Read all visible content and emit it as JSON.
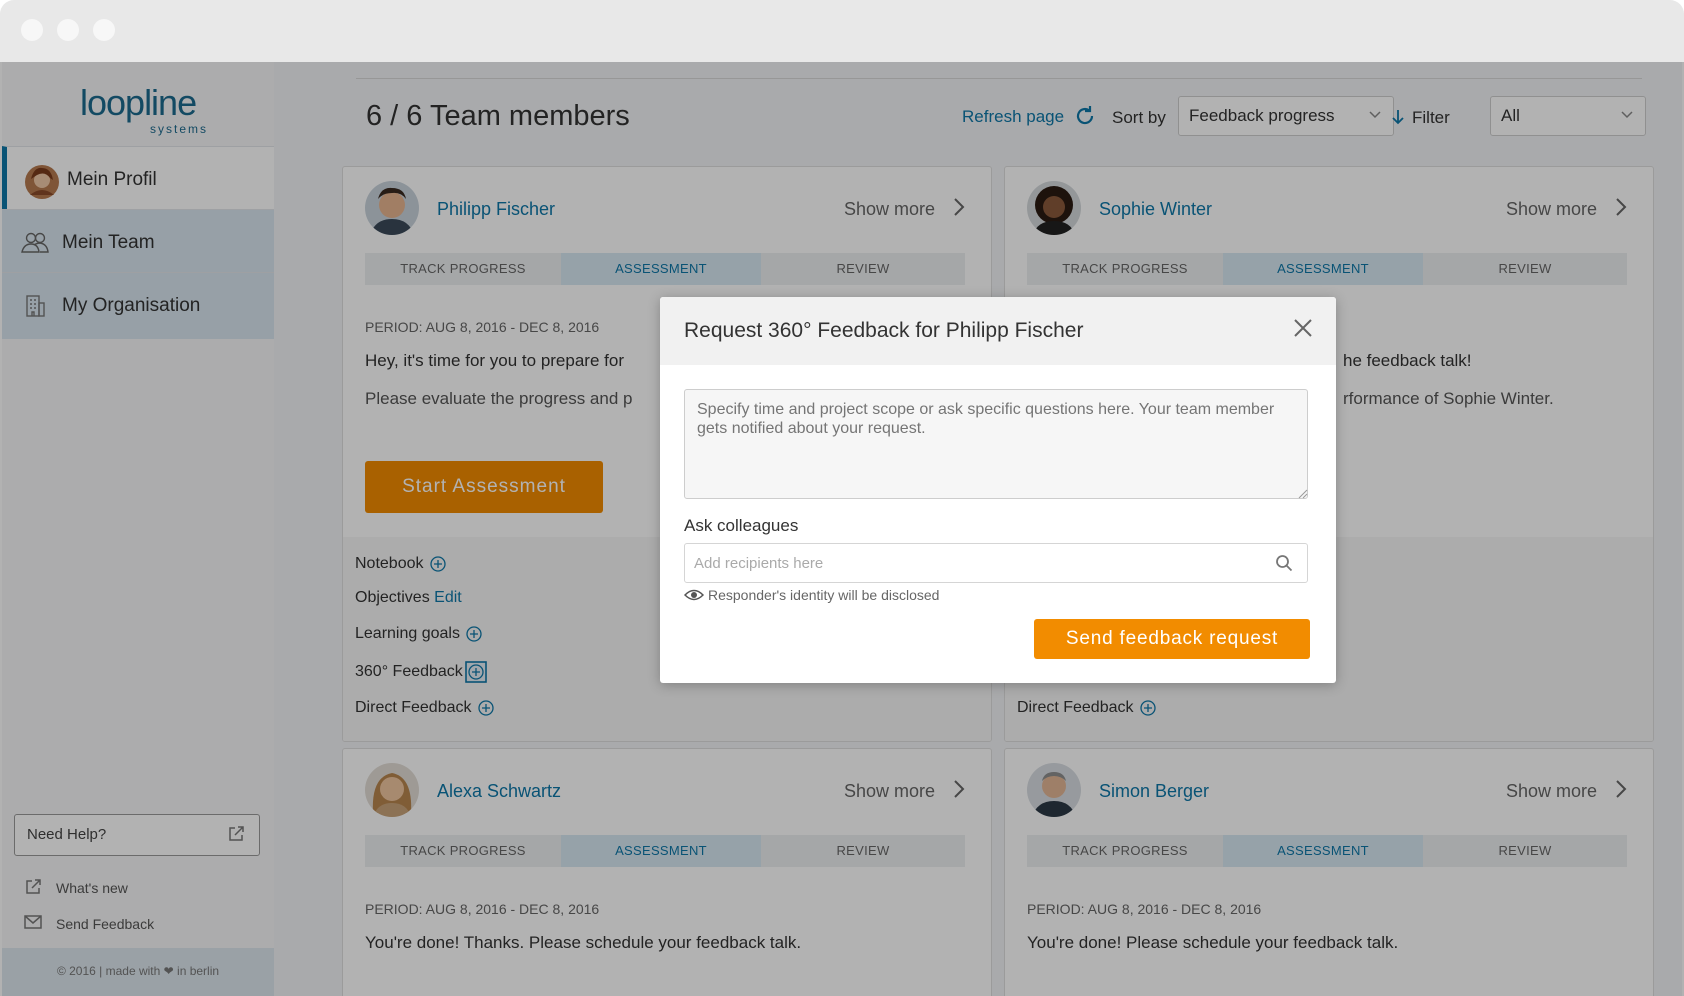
{
  "window": {
    "title": ""
  },
  "brand": {
    "name": "loopline",
    "sub": "systems",
    "accent": "#0e77a8",
    "orange": "#f28c00"
  },
  "sidebar": {
    "items": [
      {
        "label": "Mein Profil",
        "icon": "avatar"
      },
      {
        "label": "Mein Team",
        "icon": "team-icon"
      },
      {
        "label": "My Organisation",
        "icon": "building-icon"
      }
    ],
    "help": "Need Help?",
    "whats_new": "What's new",
    "send_feedback": "Send Feedback",
    "copyright": "© 2016 | made with ❤ in berlin"
  },
  "header": {
    "title": "6 / 6 Team members",
    "refresh": "Refresh page",
    "sort_label": "Sort by",
    "sort_value": "Feedback progress",
    "filter_label": "Filter",
    "filter_value": "All"
  },
  "steps": {
    "track": "TRACK PROGRESS",
    "assessment": "ASSESSMENT",
    "review": "REVIEW"
  },
  "cards": [
    {
      "name": "Philipp Fischer",
      "show_more": "Show more",
      "period": "PERIOD: AUG 8, 2016 - DEC 8, 2016",
      "msg1": "Hey, it's time for you to prepare for",
      "msg2": "Please evaluate the progress and p",
      "button": "Start Assessment",
      "foot": {
        "notebook": "Notebook",
        "objectives": "Objectives",
        "edit": "Edit",
        "learning": "Learning goals",
        "feedback360": "360° Feedback",
        "direct": "Direct Feedback"
      }
    },
    {
      "name": "Sophie Winter",
      "show_more": "Show more",
      "msg1": "he feedback talk!",
      "msg2": "rformance of Sophie Winter.",
      "foot": {
        "direct": "Direct Feedback"
      }
    },
    {
      "name": "Alexa Schwartz",
      "show_more": "Show more",
      "period": "PERIOD: AUG 8, 2016 - DEC 8, 2016",
      "msg1": "You're done! Thanks. Please schedule your feedback talk."
    },
    {
      "name": "Simon Berger",
      "show_more": "Show more",
      "period": "PERIOD: AUG 8, 2016 - DEC 8, 2016",
      "msg1": "You're done! Please schedule your feedback talk."
    }
  ],
  "modal": {
    "title": "Request 360° Feedback for Philipp Fischer",
    "textarea_placeholder": "Specify time and project scope or ask specific questions here. Your team member gets notified about your request.",
    "ask_label": "Ask colleagues",
    "recipients_placeholder": "Add recipients here",
    "disclosure": "Responder's identity will be disclosed",
    "send_button": "Send feedback request"
  }
}
